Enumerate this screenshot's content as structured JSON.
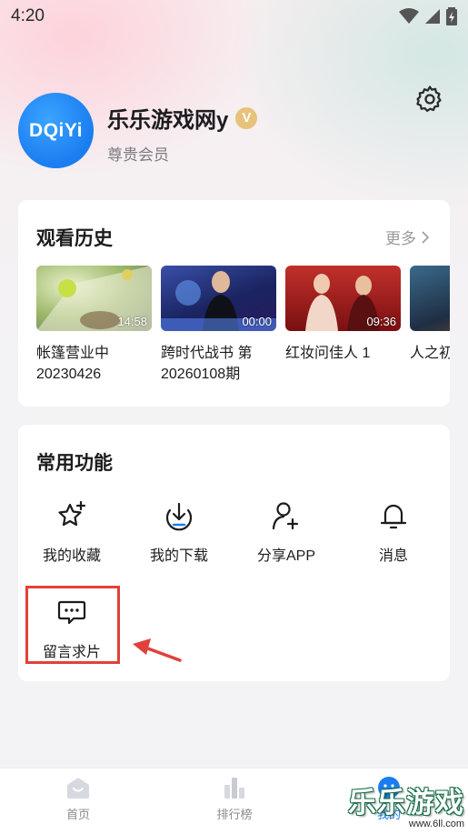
{
  "status_bar": {
    "time": "4:20"
  },
  "profile": {
    "avatar_text": "DQiYi",
    "username": "乐乐游戏网y",
    "badge": "V",
    "member_level": "尊贵会员"
  },
  "history": {
    "title": "观看历史",
    "more_label": "更多",
    "items": [
      {
        "title": "帐篷营业中 20230426",
        "duration": "14:58"
      },
      {
        "title": "跨时代战书 第20260108期",
        "duration": "00:00"
      },
      {
        "title": "红妆问佳人 1",
        "duration": "09:36"
      },
      {
        "title": "人之初 看版",
        "duration": ""
      }
    ]
  },
  "functions": {
    "title": "常用功能",
    "items": [
      {
        "label": "我的收藏",
        "icon": "star-plus-icon"
      },
      {
        "label": "我的下载",
        "icon": "download-icon"
      },
      {
        "label": "分享APP",
        "icon": "user-add-icon"
      },
      {
        "label": "消息",
        "icon": "bell-icon"
      },
      {
        "label": "留言求片",
        "icon": "message-icon"
      }
    ]
  },
  "tabbar": {
    "items": [
      {
        "label": "首页",
        "icon": "home-icon"
      },
      {
        "label": "排行榜",
        "icon": "ranking-icon"
      },
      {
        "label": "我的",
        "icon": "profile-icon"
      }
    ]
  },
  "watermark": {
    "text": "乐乐游戏",
    "url": "www.6ll.com"
  },
  "colors": {
    "accent": "#1a7df0",
    "highlight": "#e0413a",
    "badge": "#e7c27a"
  }
}
